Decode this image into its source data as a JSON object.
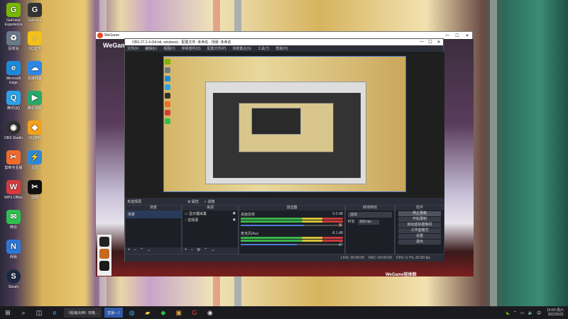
{
  "desktop_icons": [
    {
      "label": "GeForce Experience",
      "icon": "geforce-icon",
      "color": "#76b900"
    },
    {
      "label": "回收站",
      "icon": "recycle-bin-icon",
      "color": "#6a7a8a"
    },
    {
      "label": "Microsoft Edge",
      "icon": "edge-icon",
      "color": "#1d8ad8"
    },
    {
      "label": "腾讯QQ",
      "icon": "qq-icon",
      "color": "#2aa4ea"
    },
    {
      "label": "OBS Studio",
      "icon": "obs-icon",
      "color": "#303030"
    },
    {
      "label": "剪映专业版",
      "icon": "jianying-icon",
      "color": "#f06b2c"
    },
    {
      "label": "WPS Office",
      "icon": "wps-icon",
      "color": "#d93a3a"
    },
    {
      "label": "微信",
      "icon": "wechat-icon",
      "color": "#2dc24f"
    },
    {
      "label": "网易",
      "icon": "netease-icon",
      "color": "#2d78d6"
    },
    {
      "label": "Steam",
      "icon": "steam-icon",
      "color": "#1b2a44"
    },
    {
      "label": "GeForce",
      "icon": "geforce-app-icon",
      "color": "#333333"
    },
    {
      "label": "QQ音乐",
      "icon": "qq-music-icon",
      "color": "#f2c11c"
    },
    {
      "label": "百度网盘",
      "icon": "baidu-pan-icon",
      "color": "#2e86e6"
    },
    {
      "label": "腾讯视频",
      "icon": "tencent-video-icon",
      "color": "#2aa76a"
    },
    {
      "label": "QQ游戏",
      "icon": "qq-game-icon",
      "color": "#f4a11d"
    },
    {
      "label": "迅雷",
      "icon": "thunder-icon",
      "color": "#2d89d8"
    },
    {
      "label": "剪映",
      "icon": "capcut-icon",
      "color": "#111111"
    }
  ],
  "outer_window": {
    "title": "WeGame",
    "logo_text": "WeGame",
    "tag": "WeGame轻体验",
    "controls": [
      "—",
      "☐",
      "✕"
    ]
  },
  "obs": {
    "title": "OBS 27.2.4 (64-bit, windows) - 配置文件: 未命名 - 场景: 未命名",
    "controls": [
      "—",
      "☐",
      "✕"
    ],
    "menu": [
      "文件(F)",
      "编辑(E)",
      "视图(V)",
      "停靠部件(D)",
      "配置文件(P)",
      "场景集合(S)",
      "工具(T)",
      "帮助(H)"
    ],
    "toolbar": {
      "no_source": "未选择源",
      "properties": "属性",
      "filters": "滤镜"
    },
    "docks": {
      "scenes": {
        "title": "场景",
        "items": [
          "场景"
        ]
      },
      "sources": {
        "title": "来源",
        "items": [
          "显示器采集",
          "音频源"
        ]
      },
      "mixer": {
        "title": "混音器",
        "channels": [
          {
            "name": "桌面音频",
            "db": "0.0 dB",
            "level": 0.62
          },
          {
            "name": "麦克风/Aux",
            "db": "-8.1 dB",
            "level": 0.55
          }
        ]
      },
      "transitions": {
        "title": "转场特效",
        "type": "淡出",
        "duration_label": "时长",
        "duration": "300 ms"
      },
      "controls": {
        "title": "控件",
        "buttons": [
          "停止录像",
          "开始录制",
          "启动虚拟摄像机",
          "工作室模式",
          "设置",
          "退出"
        ]
      }
    },
    "status": {
      "live": "LIVE: 00:00:00",
      "rec": "REC: 00:00:00",
      "cpu": "CPU: 0.7%, 60.00 fps"
    }
  },
  "taskbar": {
    "start_icon": "windows-start-icon",
    "apps": [
      {
        "label": "《骰鬼出神》攻略…",
        "icon": "edge-icon",
        "active": false
      },
      {
        "label": "直播—1",
        "icon": "obs-icon",
        "active": true
      }
    ],
    "tray_icons": [
      "nvidia-tray-icon",
      "chevron-up-icon",
      "network-icon",
      "volume-icon",
      "ime-icon"
    ],
    "ime": "中",
    "time": "15:50 周六",
    "date": "2022/5/21"
  }
}
